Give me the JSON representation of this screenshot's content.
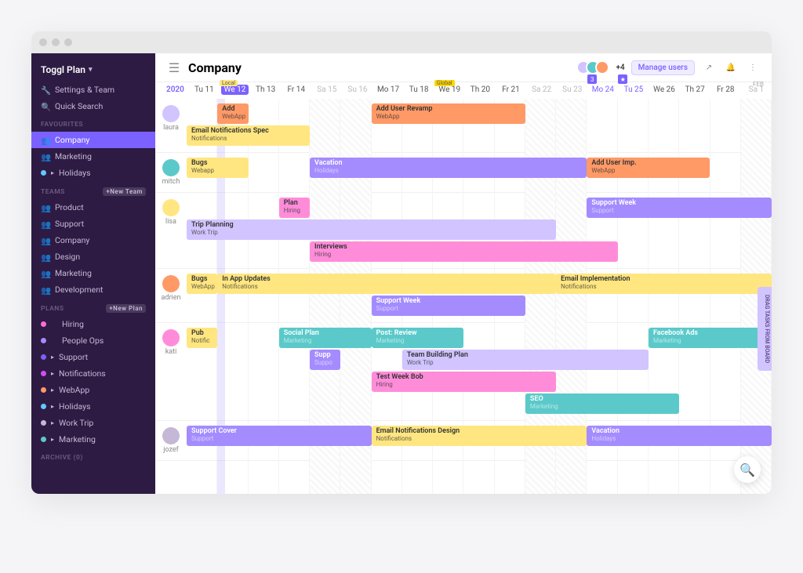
{
  "brand": "Toggl Plan",
  "settings": "Settings & Team",
  "search": "Quick Search",
  "sections": {
    "fav": "FAVOURITES",
    "teams": "TEAMS",
    "plans": "PLANS",
    "archive": "ARCHIVE (0)",
    "newTeam": "+New Team",
    "newPlan": "+New Plan"
  },
  "favItems": [
    {
      "label": "Company",
      "active": true
    },
    {
      "label": "Marketing"
    },
    {
      "label": "Holidays",
      "dot": "#64c8ff",
      "chev": true
    }
  ],
  "teamItems": [
    "Product",
    "Support",
    "Company",
    "Design",
    "Marketing",
    "Development"
  ],
  "planItems": [
    {
      "label": "Hiring",
      "dot": "#ff6bd6"
    },
    {
      "label": "People Ops",
      "dot": "#a48cff"
    },
    {
      "label": "Support",
      "dot": "#7b61ff",
      "chev": true
    },
    {
      "label": "Notifications",
      "dot": "#d84aff",
      "chev": true
    },
    {
      "label": "WebApp",
      "dot": "#ff9966",
      "chev": true
    },
    {
      "label": "Holidays",
      "dot": "#64c8ff",
      "chev": true
    },
    {
      "label": "Work Trip",
      "dot": "#c5b8d6",
      "chev": true
    },
    {
      "label": "Marketing",
      "dot": "#5bc9c9",
      "chev": true
    }
  ],
  "title": "Company",
  "plusCount": "+4",
  "manage": "Manage users",
  "year": "2020",
  "feb": "FEB",
  "days": [
    {
      "l": "Tu 11"
    },
    {
      "l": "We 12",
      "today": true
    },
    {
      "l": "Th 13"
    },
    {
      "l": "Fr 14"
    },
    {
      "l": "Sa 15",
      "we": true
    },
    {
      "l": "Su 16",
      "we": true
    },
    {
      "l": "Mo 17"
    },
    {
      "l": "Tu 18"
    },
    {
      "l": "We 19",
      "global": true
    },
    {
      "l": "Th 20"
    },
    {
      "l": "Fr 21"
    },
    {
      "l": "Sa 22",
      "we": true
    },
    {
      "l": "Su 23",
      "we": true
    },
    {
      "l": "Mo 24",
      "pin": "3"
    },
    {
      "l": "Tu 25",
      "pin": "★"
    },
    {
      "l": "We 26"
    },
    {
      "l": "Th 27"
    },
    {
      "l": "Fr 28"
    },
    {
      "l": "Sa 1",
      "we": true
    }
  ],
  "badge_local": "Local",
  "badge_global": "Global",
  "dragLabel": "DRAG TASKS FROM BOARD",
  "people": [
    {
      "name": "laura",
      "color": "#d1c4ff",
      "lanes": [
        [
          {
            "t": "Add",
            "s": "WebApp",
            "c": "orange",
            "x": 1,
            "w": 1
          },
          {
            "t": "Add User Revamp",
            "s": "WebApp",
            "c": "orange",
            "x": 6,
            "w": 5
          }
        ],
        [
          {
            "t": "Email Notifications Spec",
            "s": "Notifications",
            "c": "yellow",
            "x": 0,
            "w": 4
          }
        ]
      ]
    },
    {
      "name": "mitch",
      "color": "#5bc9c9",
      "lanes": [
        [
          {
            "t": "Bugs",
            "s": "Webapp",
            "c": "yellow",
            "x": 0,
            "w": 2
          },
          {
            "t": "Vacation",
            "s": "Holidays",
            "c": "purple",
            "x": 4,
            "w": 9
          },
          {
            "t": "Add User Imp.",
            "s": "WebApp",
            "c": "orange",
            "x": 13,
            "w": 4
          }
        ]
      ]
    },
    {
      "name": "lisa",
      "color": "#ffe680",
      "lanes": [
        [
          {
            "t": "Plan",
            "s": "Hiring",
            "c": "pink",
            "x": 3,
            "w": 1
          },
          {
            "t": "Support Week",
            "s": "Support",
            "c": "purple",
            "x": 13,
            "w": 6
          }
        ],
        [
          {
            "t": "Trip Planning",
            "s": "Work Trip",
            "c": "lav",
            "x": 0,
            "w": 12
          }
        ],
        [
          {
            "t": "Interviews",
            "s": "Hiring",
            "c": "pink",
            "x": 4,
            "w": 10
          }
        ]
      ]
    },
    {
      "name": "adrien",
      "color": "#ff9966",
      "lanes": [
        [
          {
            "t": "Bugs",
            "s": "WebApp",
            "c": "yellow",
            "x": 0,
            "w": 1
          },
          {
            "t": "In App Updates",
            "s": "Notifications",
            "c": "yellow",
            "x": 1,
            "w": 11
          },
          {
            "t": "Email Implementation",
            "s": "Notifications",
            "c": "yellow",
            "x": 12,
            "w": 7
          }
        ],
        [
          {
            "t": "Support Week",
            "s": "Support",
            "c": "purple",
            "x": 6,
            "w": 5
          }
        ]
      ]
    },
    {
      "name": "kati",
      "color": "#ff8cd9",
      "lanes": [
        [
          {
            "t": "Pub",
            "s": "Notific",
            "c": "yellow",
            "x": 0,
            "w": 1
          },
          {
            "t": "Social Plan",
            "s": "Marketing",
            "c": "teal",
            "x": 3,
            "w": 3
          },
          {
            "t": "Post: Review",
            "s": "Marketing",
            "c": "teal",
            "x": 6,
            "w": 3
          },
          {
            "t": "Facebook Ads",
            "s": "Marketing",
            "c": "teal",
            "x": 15,
            "w": 4
          }
        ],
        [
          {
            "t": "Supp",
            "s": "Suppo",
            "c": "purple",
            "x": 4,
            "w": 1
          },
          {
            "t": "Team Building Plan",
            "s": "Work Trip",
            "c": "lav",
            "x": 7,
            "w": 8
          }
        ],
        [
          {
            "t": "Test Week Bob",
            "s": "Hiring",
            "c": "pink",
            "x": 6,
            "w": 6
          }
        ],
        [
          {
            "t": "SEO",
            "s": "Marketing",
            "c": "teal",
            "x": 11,
            "w": 5
          }
        ]
      ]
    },
    {
      "name": "jozef",
      "color": "#c5b8d6",
      "lanes": [
        [
          {
            "t": "Support Cover",
            "s": "Support",
            "c": "purple",
            "x": 0,
            "w": 6
          },
          {
            "t": "Email Notifications Design",
            "s": "Notifications",
            "c": "yellow",
            "x": 6,
            "w": 7
          },
          {
            "t": "Vacation",
            "s": "Holidays",
            "c": "purple",
            "x": 13,
            "w": 6
          }
        ]
      ]
    }
  ]
}
